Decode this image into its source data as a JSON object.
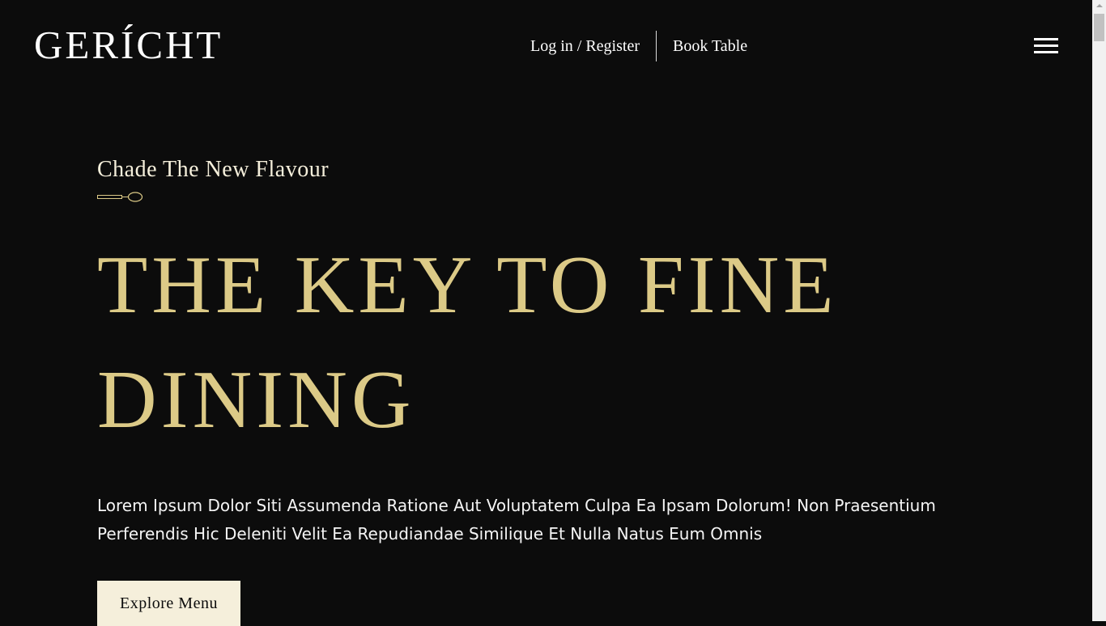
{
  "header": {
    "logo": "GERÍCHT",
    "nav": {
      "login_register": "Log in / Register",
      "book_table": "Book Table"
    },
    "menu_icon": "hamburger-menu-icon"
  },
  "hero": {
    "subtitle": "Chade The New Flavour",
    "divider_icon": "spoon-icon",
    "title": "THE KEY TO FINE DINING",
    "description": "Lorem Ipsum Dolor Siti Assumenda Ratione Aut Voluptatem Culpa Ea Ipsam Dolorum! Non Praesentium Perferendis Hic Deleniti Velit Ea Repudiandae Similique Et Nulla Natus Eum Omnis",
    "cta_label": "Explore Menu"
  },
  "colors": {
    "background": "#0c0c0c",
    "gold": "#dcca87",
    "cream": "#f5efdb",
    "white": "#ffffff"
  }
}
